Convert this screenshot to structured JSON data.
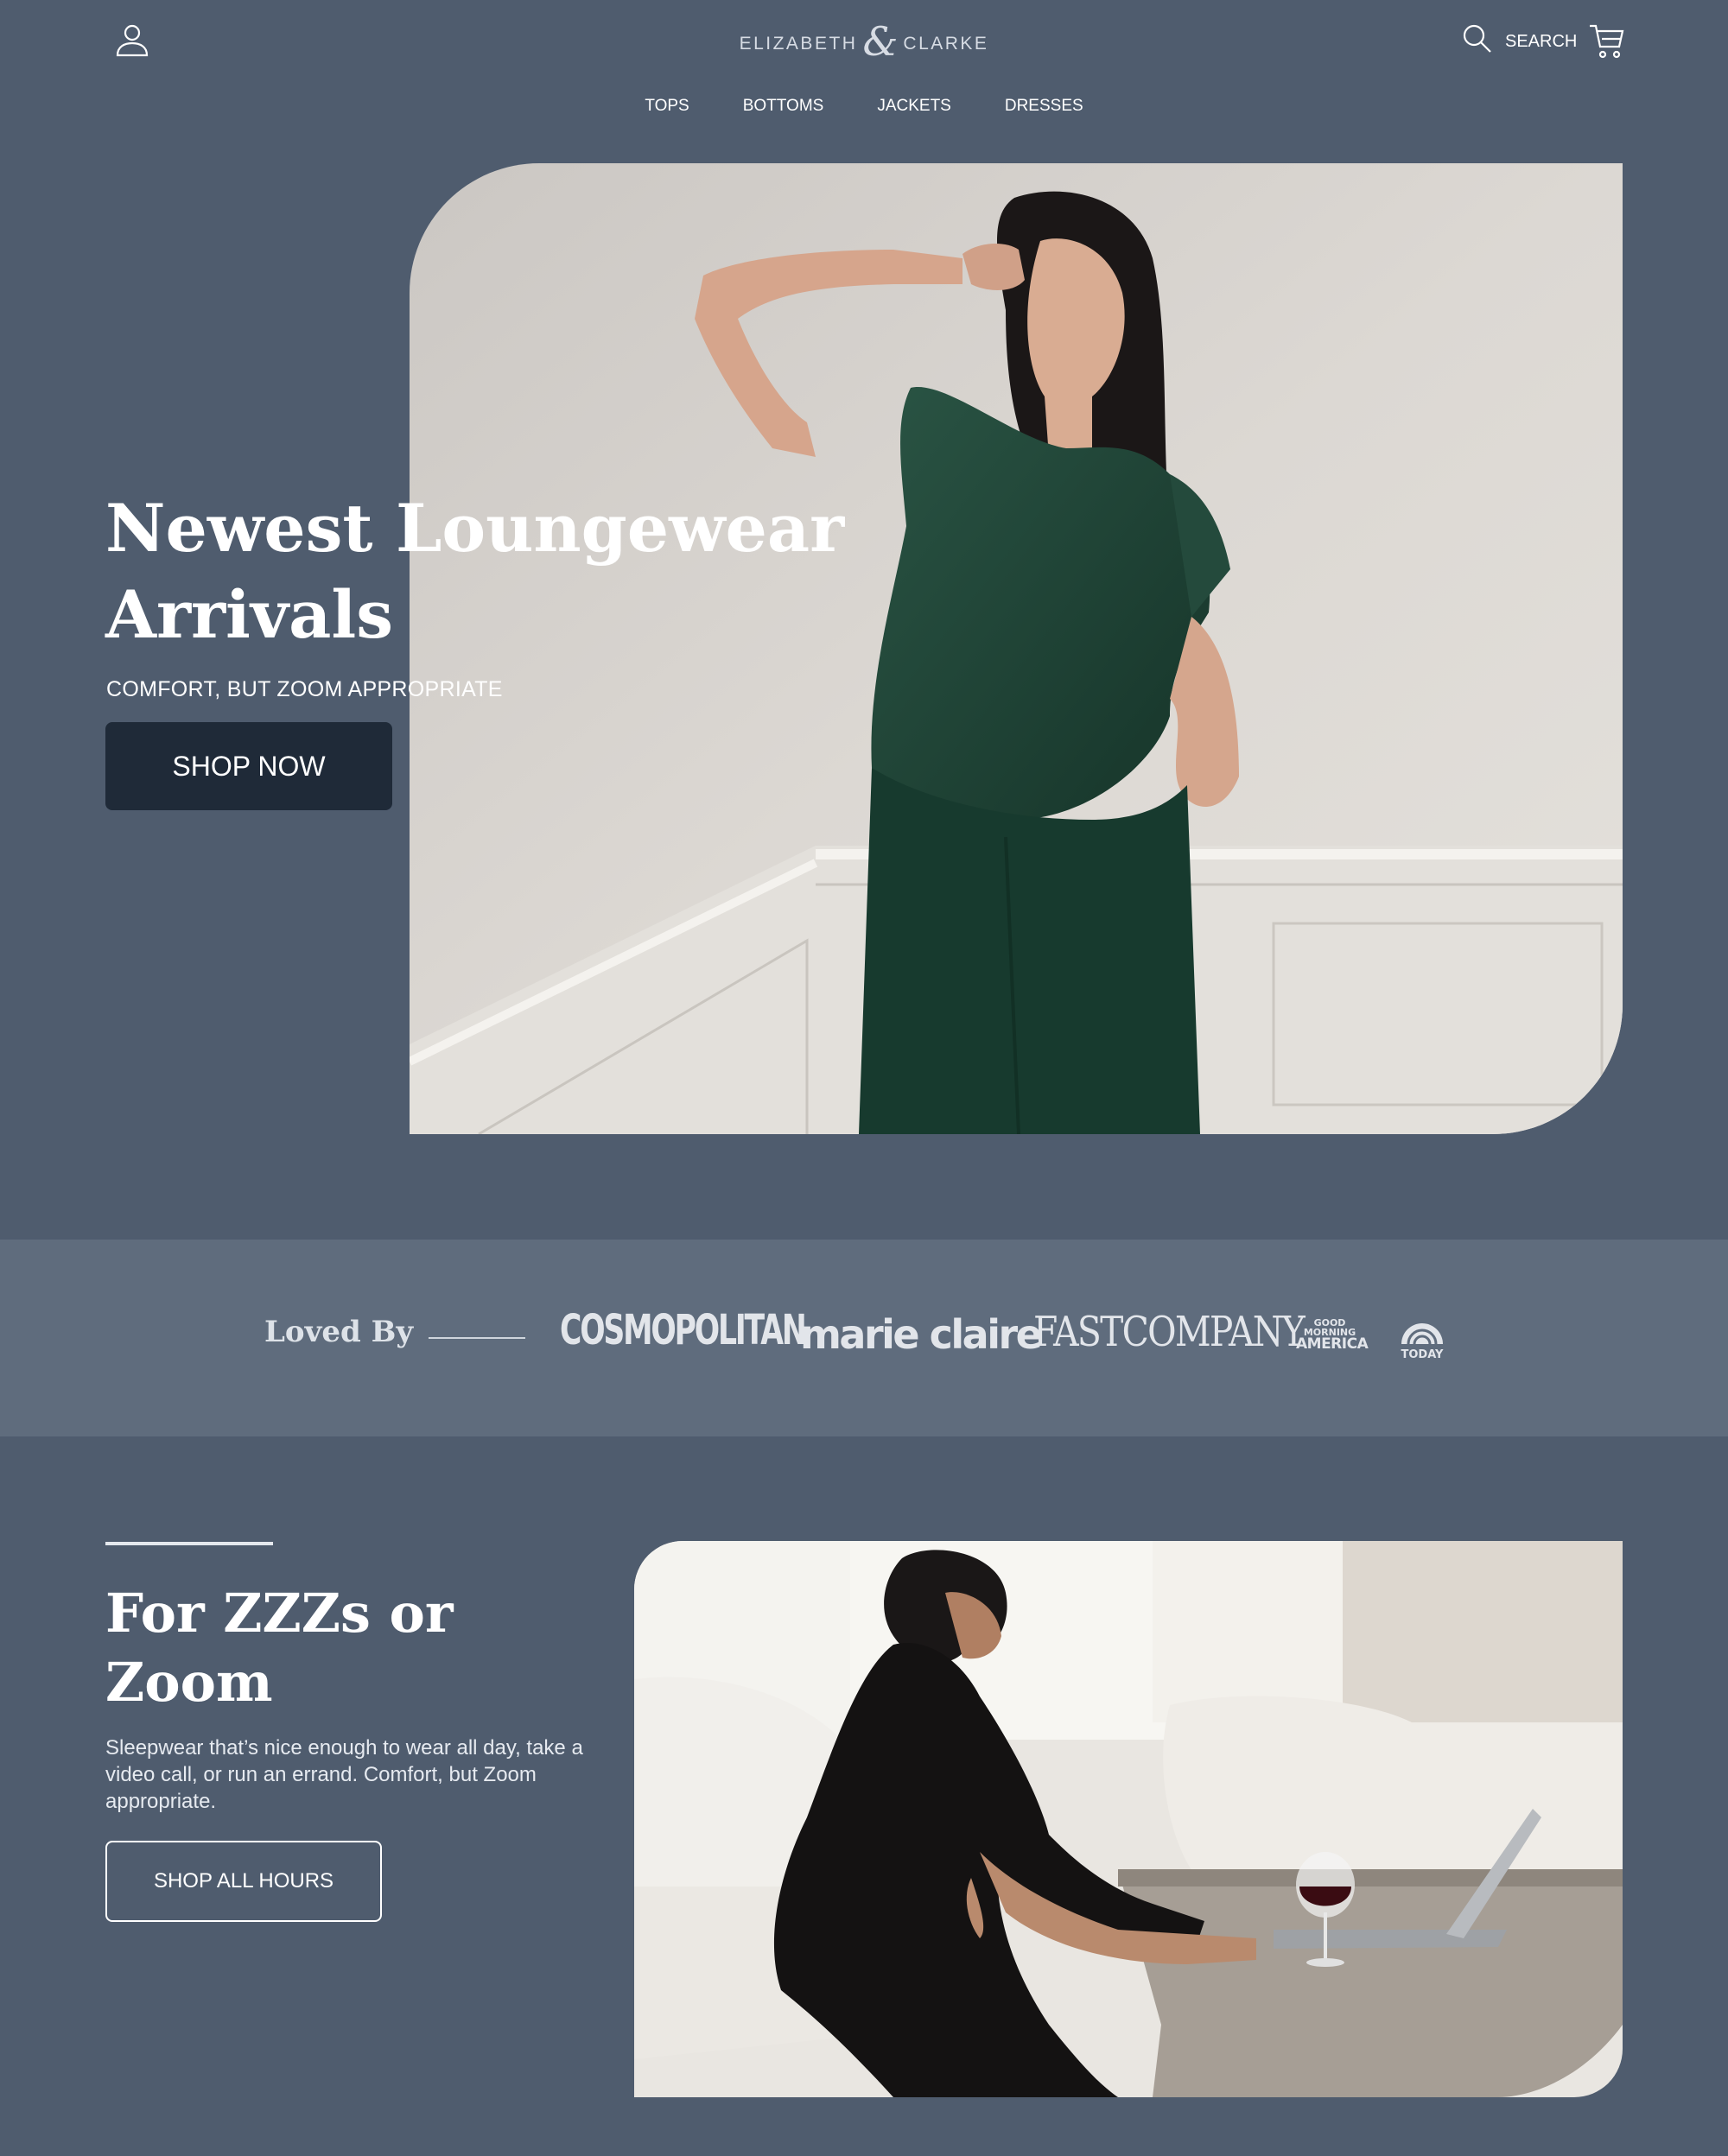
{
  "header": {
    "brand_left": "ELIZABETH",
    "brand_amp": "&",
    "brand_right": "CLARKE",
    "search_label": "SEARCH",
    "account_icon": "user-icon",
    "search_icon": "magnifier-icon",
    "cart_icon": "cart-icon"
  },
  "nav": {
    "items": [
      {
        "label": "TOPS"
      },
      {
        "label": "BOTTOMS"
      },
      {
        "label": "JACKETS"
      },
      {
        "label": "DRESSES"
      }
    ]
  },
  "hero": {
    "title_line1": "Newest Loungewear",
    "title_line2": "Arrivals",
    "subtitle": "COMFORT, BUT ZOOM APPROPRIATE",
    "cta_label": "SHOP NOW"
  },
  "press": {
    "heading": "Loved By",
    "logos": [
      {
        "name": "COSMOPOLITAN"
      },
      {
        "name": "marie claire"
      },
      {
        "name": "FAST COMPANY",
        "display": "FASTCOMPANY"
      },
      {
        "name": "GOOD MORNING AMERICA",
        "line1": "GOOD",
        "line2": "MORNING",
        "line3": "AMERICA"
      },
      {
        "name": "TODAY"
      }
    ]
  },
  "feature": {
    "title_line1": "For ZZZs or",
    "title_line2": "Zoom",
    "body": "Sleepwear that’s nice enough to wear all day, take a video call, or run an errand. Comfort, but Zoom appropriate.",
    "cta_label": "SHOP ALL HOURS"
  },
  "colors": {
    "page_bg": "#4f5c6e",
    "press_band": "#5f6c7d",
    "primary_button": "#1f2a38",
    "top_green": "#1f4436"
  }
}
